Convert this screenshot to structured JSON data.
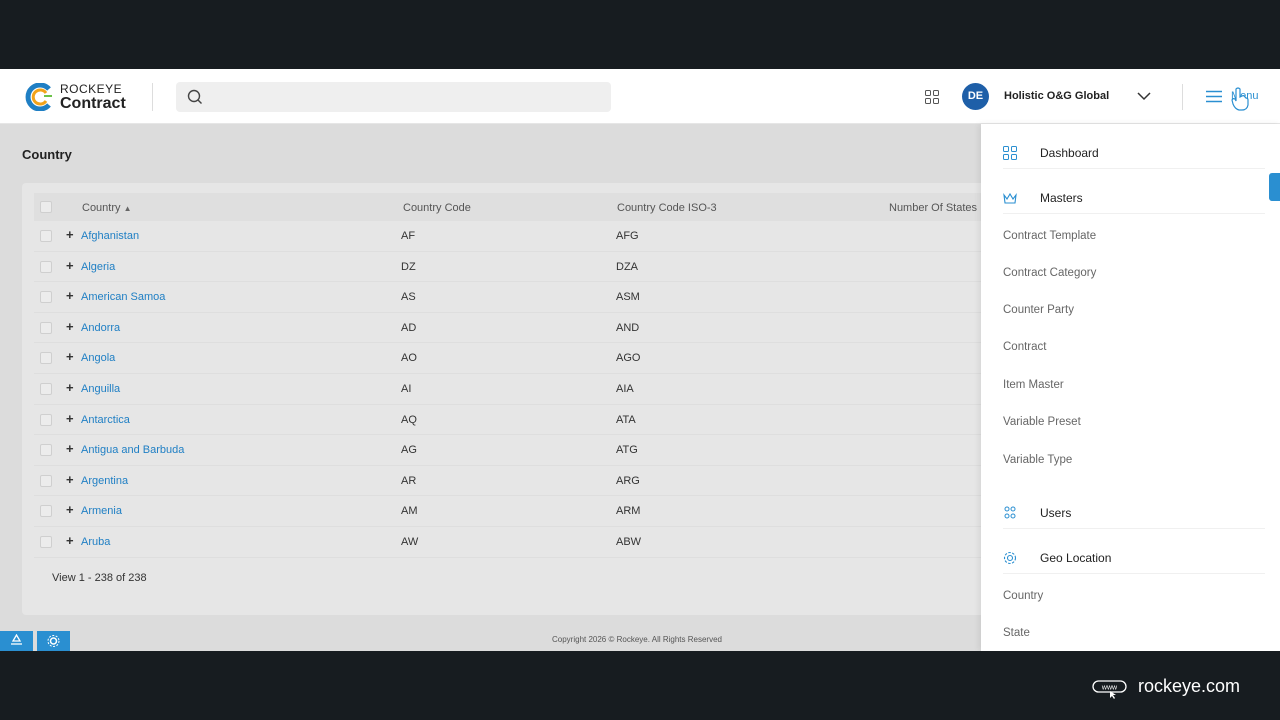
{
  "header": {
    "logo_top": "ROCKEYE",
    "logo_bottom": "Contract",
    "search_placeholder": "",
    "avatar_initials": "DE",
    "org_name": "Holistic O&G Global",
    "menu_label": "Menu"
  },
  "page": {
    "title": "Country"
  },
  "table": {
    "columns": [
      "Country",
      "Country Code",
      "Country Code ISO-3",
      "Number Of States"
    ],
    "rows": [
      {
        "country": "Afghanistan",
        "code": "AF",
        "iso3": "AFG"
      },
      {
        "country": "Algeria",
        "code": "DZ",
        "iso3": "DZA"
      },
      {
        "country": "American Samoa",
        "code": "AS",
        "iso3": "ASM"
      },
      {
        "country": "Andorra",
        "code": "AD",
        "iso3": "AND"
      },
      {
        "country": "Angola",
        "code": "AO",
        "iso3": "AGO"
      },
      {
        "country": "Anguilla",
        "code": "AI",
        "iso3": "AIA"
      },
      {
        "country": "Antarctica",
        "code": "AQ",
        "iso3": "ATA"
      },
      {
        "country": "Antigua and Barbuda",
        "code": "AG",
        "iso3": "ATG"
      },
      {
        "country": "Argentina",
        "code": "AR",
        "iso3": "ARG"
      },
      {
        "country": "Armenia",
        "code": "AM",
        "iso3": "ARM"
      },
      {
        "country": "Aruba",
        "code": "AW",
        "iso3": "ABW"
      }
    ],
    "pager": "View 1 - 238 of 238"
  },
  "footer": {
    "copyright": "Copyright 2026 © Rockeye. All Rights Reserved"
  },
  "sidebar": {
    "dashboard": "Dashboard",
    "masters": "Masters",
    "masters_items": [
      "Contract Template",
      "Contract Category",
      "Counter Party",
      "Contract",
      "Item Master",
      "Variable Preset",
      "Variable Type"
    ],
    "users": "Users",
    "geo_location": "Geo Location",
    "geo_items": [
      "Country",
      "State"
    ]
  },
  "brand": {
    "url": "rockeye.com"
  },
  "colors": {
    "accent": "#2a8fd1",
    "link": "#1f7fc4",
    "avatar": "#1e5fa8",
    "frame": "#171c20"
  }
}
